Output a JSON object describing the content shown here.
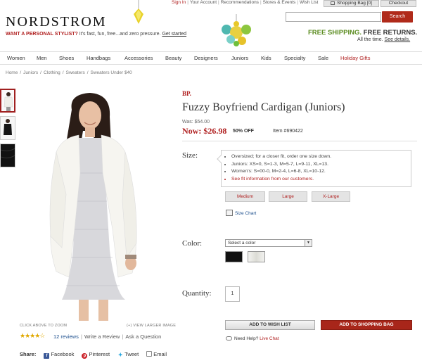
{
  "header": {
    "logo": "NORDSTROM",
    "stylist_strong": "WANT A PERSONAL STYLIST?",
    "stylist_text": " It's fast, fun, free...and zero pressure.",
    "stylist_link": "Get started",
    "top_links": [
      "Sign In",
      "Your Account",
      "Recommendations",
      "Stores & Events",
      "Wish List"
    ],
    "bag_label": "Shopping Bag [0]",
    "checkout_label": "Checkout",
    "search_placeholder": "",
    "search_button": "Search",
    "shipping_free": "FREE SHIPPING.",
    "shipping_returns": "FREE RETURNS.",
    "shipping_note": "All the time.",
    "shipping_link": "See details."
  },
  "nav": {
    "items": [
      "Women",
      "Men",
      "Shoes",
      "Handbags",
      "Accessories",
      "Beauty",
      "Designers",
      "Juniors",
      "Kids",
      "Specialty",
      "Sale",
      "Holiday Gifts"
    ]
  },
  "breadcrumb": [
    "Home",
    "Juniors",
    "Clothing",
    "Sweaters",
    "Sweaters Under $40"
  ],
  "gallery": {
    "click_zoom": "CLICK ABOVE TO ZOOM",
    "view_larger": "(+) VIEW LARGER IMAGE"
  },
  "reviews": {
    "stars": "★★★★☆",
    "count": "12 reviews",
    "write": "Write a Review",
    "ask": "Ask a Question"
  },
  "share": {
    "label": "Share:",
    "facebook": "Facebook",
    "pinterest": "Pinterest",
    "tweet": "Tweet",
    "email": "Email"
  },
  "product": {
    "brand": "BP.",
    "title": "Fuzzy Boyfriend Cardigan (Juniors)",
    "was": "Was: $54.00",
    "now": "Now: $26.98",
    "off": "50% OFF",
    "item": "Item #690422",
    "size_label": "Size:",
    "size_info": [
      "Oversized; for a closer fit, order one size down.",
      "Juniors: XS=0, S=1-3, M=5-7, L=9-11, XL=13.",
      "Women's: S=00-0, M=2-4, L=6-8, XL=10-12."
    ],
    "size_fit_link": "See fit information from our customers.",
    "sizes": [
      "Medium",
      "Large",
      "X-Large"
    ],
    "size_chart": "Size Chart",
    "color_label": "Color:",
    "color_select": "Select a color",
    "colors": [
      "#111111",
      "#f2f2ef"
    ],
    "quantity_label": "Quantity:",
    "quantity": "1",
    "wish_button": "ADD TO WISH LIST",
    "bag_button": "ADD TO SHOPPING BAG",
    "help": "Need Help?",
    "live_chat": "Live Chat"
  }
}
